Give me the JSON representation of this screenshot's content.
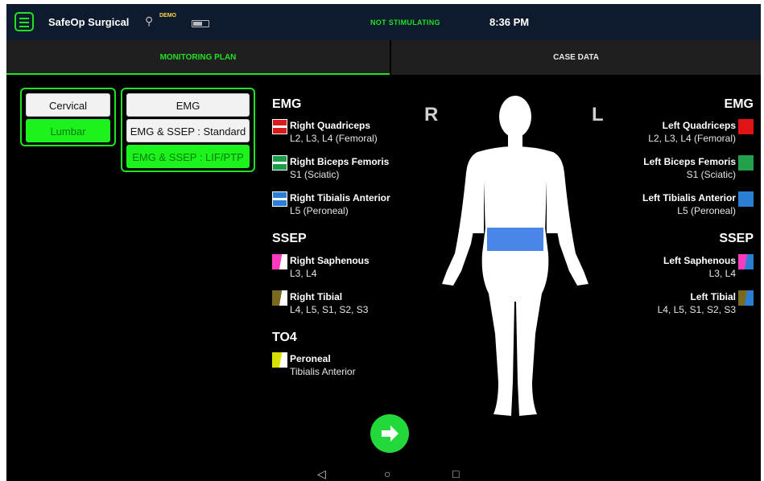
{
  "status_bar": {
    "app_title": "SafeOp Surgical",
    "demo_badge": "DEMO",
    "stimulation_status": "NOT STIMULATING",
    "time": "8:36 PM"
  },
  "tabs": [
    {
      "label": "MONITORING PLAN",
      "active": true
    },
    {
      "label": "CASE DATA",
      "active": false
    }
  ],
  "region_options": [
    {
      "label": "Cervical",
      "selected": false
    },
    {
      "label": "Lumbar",
      "selected": true
    }
  ],
  "mode_options": [
    {
      "label": "EMG",
      "selected": false
    },
    {
      "label": "EMG & SSEP : Standard",
      "selected": false
    },
    {
      "label": "EMG & SSEP : LIF/PTP",
      "selected": true
    }
  ],
  "right_side": {
    "label": "R",
    "emg_heading": "EMG",
    "emg": [
      {
        "name": "Right Quadriceps",
        "nerve": "L2, L3, L4 (Femoral)",
        "color": "#d81b1b"
      },
      {
        "name": "Right Biceps Femoris",
        "nerve": "S1 (Sciatic)",
        "color": "#1a9e4a"
      },
      {
        "name": "Right Tibialis Anterior",
        "nerve": "L5 (Peroneal)",
        "color": "#2a7fd4"
      }
    ],
    "ssep_heading": "SSEP",
    "ssep": [
      {
        "name": "Right Saphenous",
        "nerve": "L3, L4",
        "color": "#ff3ac0"
      },
      {
        "name": "Right Tibial",
        "nerve": "L4, L5, S1, S2, S3",
        "color": "#7a6a20"
      }
    ],
    "to4_heading": "TO4",
    "to4": [
      {
        "name": "Peroneal",
        "nerve": "Tibialis Anterior",
        "color": "#d8e000"
      }
    ]
  },
  "left_side": {
    "label": "L",
    "emg_heading": "EMG",
    "emg": [
      {
        "name": "Left Quadriceps",
        "nerve": "L2, L3, L4 (Femoral)",
        "color": "#e01414"
      },
      {
        "name": "Left Biceps Femoris",
        "nerve": "S1 (Sciatic)",
        "color": "#22a04a"
      },
      {
        "name": "Left Tibialis Anterior",
        "nerve": "L5 (Peroneal)",
        "color": "#2a7fd4"
      }
    ],
    "ssep_heading": "SSEP",
    "ssep": [
      {
        "name": "Left Saphenous",
        "nerve": "L3, L4",
        "color": "#ff3ac0"
      },
      {
        "name": "Left Tibial",
        "nerve": "L4, L5, S1, S2, S3",
        "color": "#7a6a20"
      }
    ]
  },
  "body_diagram": {
    "highlight_region": "lumbar",
    "highlight_color": "#4a86e8"
  },
  "icons": {
    "menu": "menu-icon",
    "usb": "usb-icon",
    "battery": "battery-icon",
    "next": "arrow-right-icon",
    "back": "back-icon",
    "home": "home-icon",
    "recents": "recents-icon"
  },
  "nav_glyphs": {
    "back": "◁",
    "home": "○",
    "recents": "□"
  },
  "accent_color": "#22e022"
}
